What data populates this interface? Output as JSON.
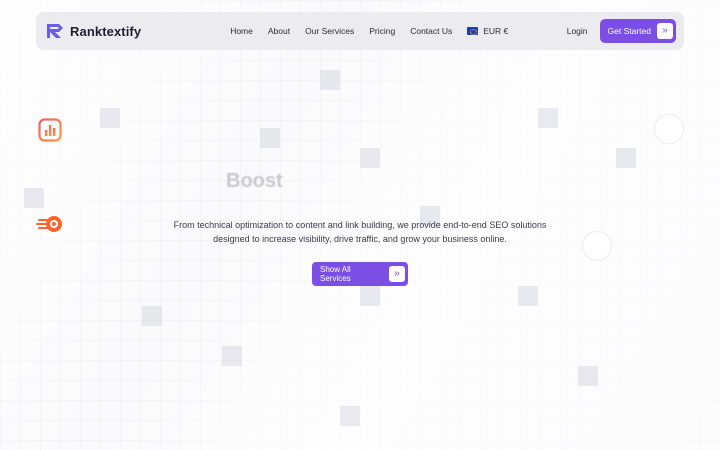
{
  "brand": {
    "name": "Ranktextify",
    "accent": "#7b4ee6"
  },
  "nav": {
    "items": [
      {
        "label": "Home"
      },
      {
        "label": "About"
      },
      {
        "label": "Our Services"
      },
      {
        "label": "Pricing"
      },
      {
        "label": "Contact Us"
      }
    ],
    "currency": "EUR €",
    "currency_icon": "eu-flag-icon",
    "login": "Login",
    "cta": "Get Started",
    "cta_icon": "chevrons-right-icon"
  },
  "hero": {
    "title": "Boost",
    "description_line1": "From technical optimization to content and link building, we provide end-to-end SEO solutions",
    "description_line2": "designed to increase visibility, drive traffic, and grow your business online.",
    "button": "Show All Services",
    "button_icon": "chevrons-right-icon"
  },
  "floating_icons": [
    "chart-app-icon",
    "semrush-logo-icon"
  ]
}
